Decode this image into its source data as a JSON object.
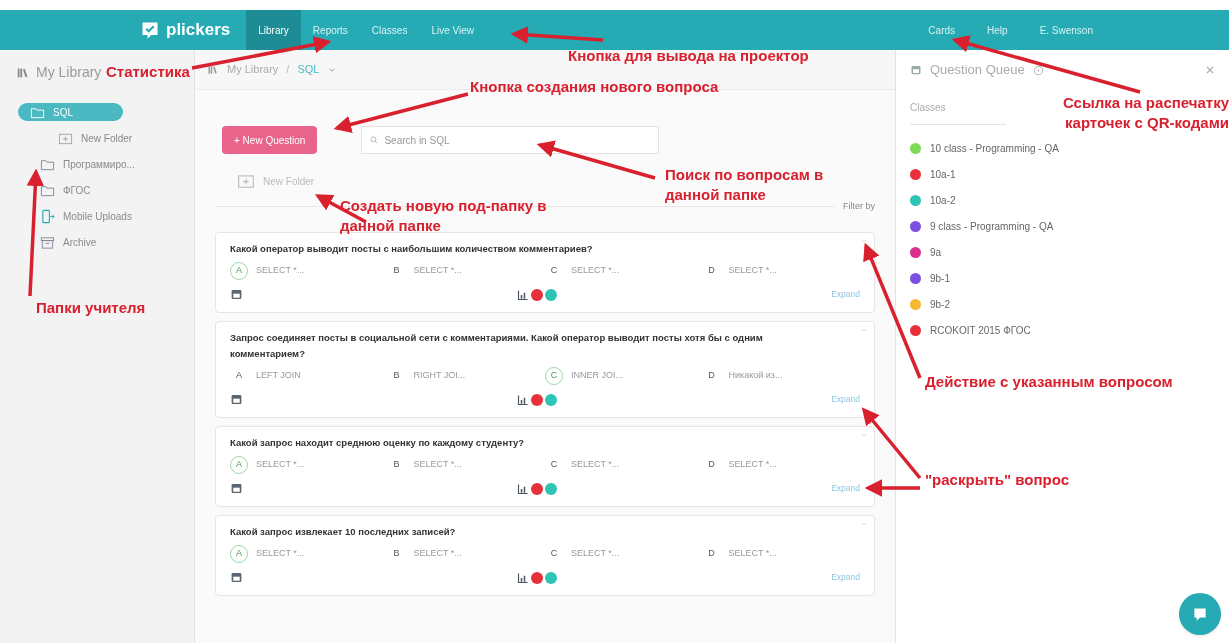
{
  "nav": {
    "logo": "plickers",
    "items": [
      {
        "label": "Library",
        "selected": true
      },
      {
        "label": "Reports",
        "selected": false
      },
      {
        "label": "Classes",
        "selected": false
      },
      {
        "label": "Live View",
        "selected": false
      }
    ],
    "right_items": [
      {
        "label": "Cards",
        "selected": false
      },
      {
        "label": "Help",
        "selected": false
      },
      {
        "label": "E. Swenson",
        "selected": false
      }
    ]
  },
  "sidebar": {
    "title": "My Library",
    "items": [
      {
        "kind": "folder",
        "label": "SQL",
        "selected": true,
        "children": [
          {
            "kind": "new-folder",
            "label": "New Folder",
            "selected": false
          }
        ]
      },
      {
        "kind": "folder",
        "label": "Программиро...",
        "selected": false
      },
      {
        "kind": "folder",
        "label": "ФГОС",
        "selected": false
      },
      {
        "kind": "mobile",
        "label": "Mobile Uploads",
        "selected": false
      },
      {
        "kind": "archive",
        "label": "Archive",
        "selected": false
      }
    ]
  },
  "breadcrumb": {
    "root": "My Library",
    "separator": "/",
    "current": "SQL"
  },
  "toolbar": {
    "new_question": "+ New Question",
    "search_placeholder": "Search in SQL",
    "new_folder": "New Folder",
    "filter": "Filter by"
  },
  "questions": [
    {
      "text": "Какой оператор выводит посты с наибольшим количеством комментариев?",
      "answers": [
        {
          "letter": "A",
          "text": "SELECT *...",
          "correct": true
        },
        {
          "letter": "B",
          "text": "SELECT *...",
          "correct": false
        },
        {
          "letter": "C",
          "text": "SELECT *...",
          "correct": false
        },
        {
          "letter": "D",
          "text": "SELECT *...",
          "correct": false
        }
      ],
      "dots": [
        {
          "color": "#e8303a"
        },
        {
          "color": "#2ec4b6"
        }
      ],
      "expand": "Expand"
    },
    {
      "text": "Запрос соединяет посты в социальной сети с комментариями. Какой оператор выводит посты хотя бы с одним комментарием?",
      "answers": [
        {
          "letter": "A",
          "text": "LEFT JOIN",
          "correct": false
        },
        {
          "letter": "B",
          "text": "RIGHT JOI...",
          "correct": false
        },
        {
          "letter": "C",
          "text": "INNER JOI...",
          "correct": true
        },
        {
          "letter": "D",
          "text": "Никакой из...",
          "correct": false
        }
      ],
      "dots": [
        {
          "color": "#e8303a"
        },
        {
          "color": "#2ec4b6"
        }
      ],
      "expand": "Expand"
    },
    {
      "text": "Какой запрос находит среднюю оценку по каждому студенту?",
      "answers": [
        {
          "letter": "A",
          "text": "SELECT *...",
          "correct": true
        },
        {
          "letter": "B",
          "text": "SELECT *...",
          "correct": false
        },
        {
          "letter": "C",
          "text": "SELECT *...",
          "correct": false
        },
        {
          "letter": "D",
          "text": "SELECT *...",
          "correct": false
        }
      ],
      "dots": [
        {
          "color": "#e8303a"
        },
        {
          "color": "#2ec4b6"
        }
      ],
      "expand": "Expand"
    },
    {
      "text": "Какой запрос извлекает 10 последних записей?",
      "answers": [
        {
          "letter": "A",
          "text": "SELECT *...",
          "correct": true
        },
        {
          "letter": "B",
          "text": "SELECT *...",
          "correct": false
        },
        {
          "letter": "C",
          "text": "SELECT *...",
          "correct": false
        },
        {
          "letter": "D",
          "text": "SELECT *...",
          "correct": false
        }
      ],
      "dots": [
        {
          "color": "#e8303a"
        },
        {
          "color": "#2ec4b6"
        }
      ],
      "expand": "Expand"
    }
  ],
  "queue": {
    "title": "Question Queue",
    "tab": "Classes",
    "classes": [
      {
        "name": "10 class - Programming - QA",
        "color": "#7ed957"
      },
      {
        "name": "10a-1",
        "color": "#e8303a"
      },
      {
        "name": "10a-2",
        "color": "#2ec4b6"
      },
      {
        "name": "9 class - Programming - QA",
        "color": "#7b4fe0"
      },
      {
        "name": "9a",
        "color": "#d9308f"
      },
      {
        "name": "9b-1",
        "color": "#7b4fe0"
      },
      {
        "name": "9b-2",
        "color": "#f5b82e"
      },
      {
        "name": "RCOKOIT 2015 ФГОС",
        "color": "#e8303a"
      }
    ]
  },
  "annotations": [
    "Статистика",
    "Кнопка для вывода на проектор",
    "Кнопка создания нового вопроса",
    "Ссылка на распечатку карточек с QR-кодами",
    "Поиск по вопросам в данной папке",
    "Создать новую под-папку в данной папке",
    "Папки учителя",
    "Действие с указанным вопросом",
    "\"раскрыть\" вопрос"
  ]
}
